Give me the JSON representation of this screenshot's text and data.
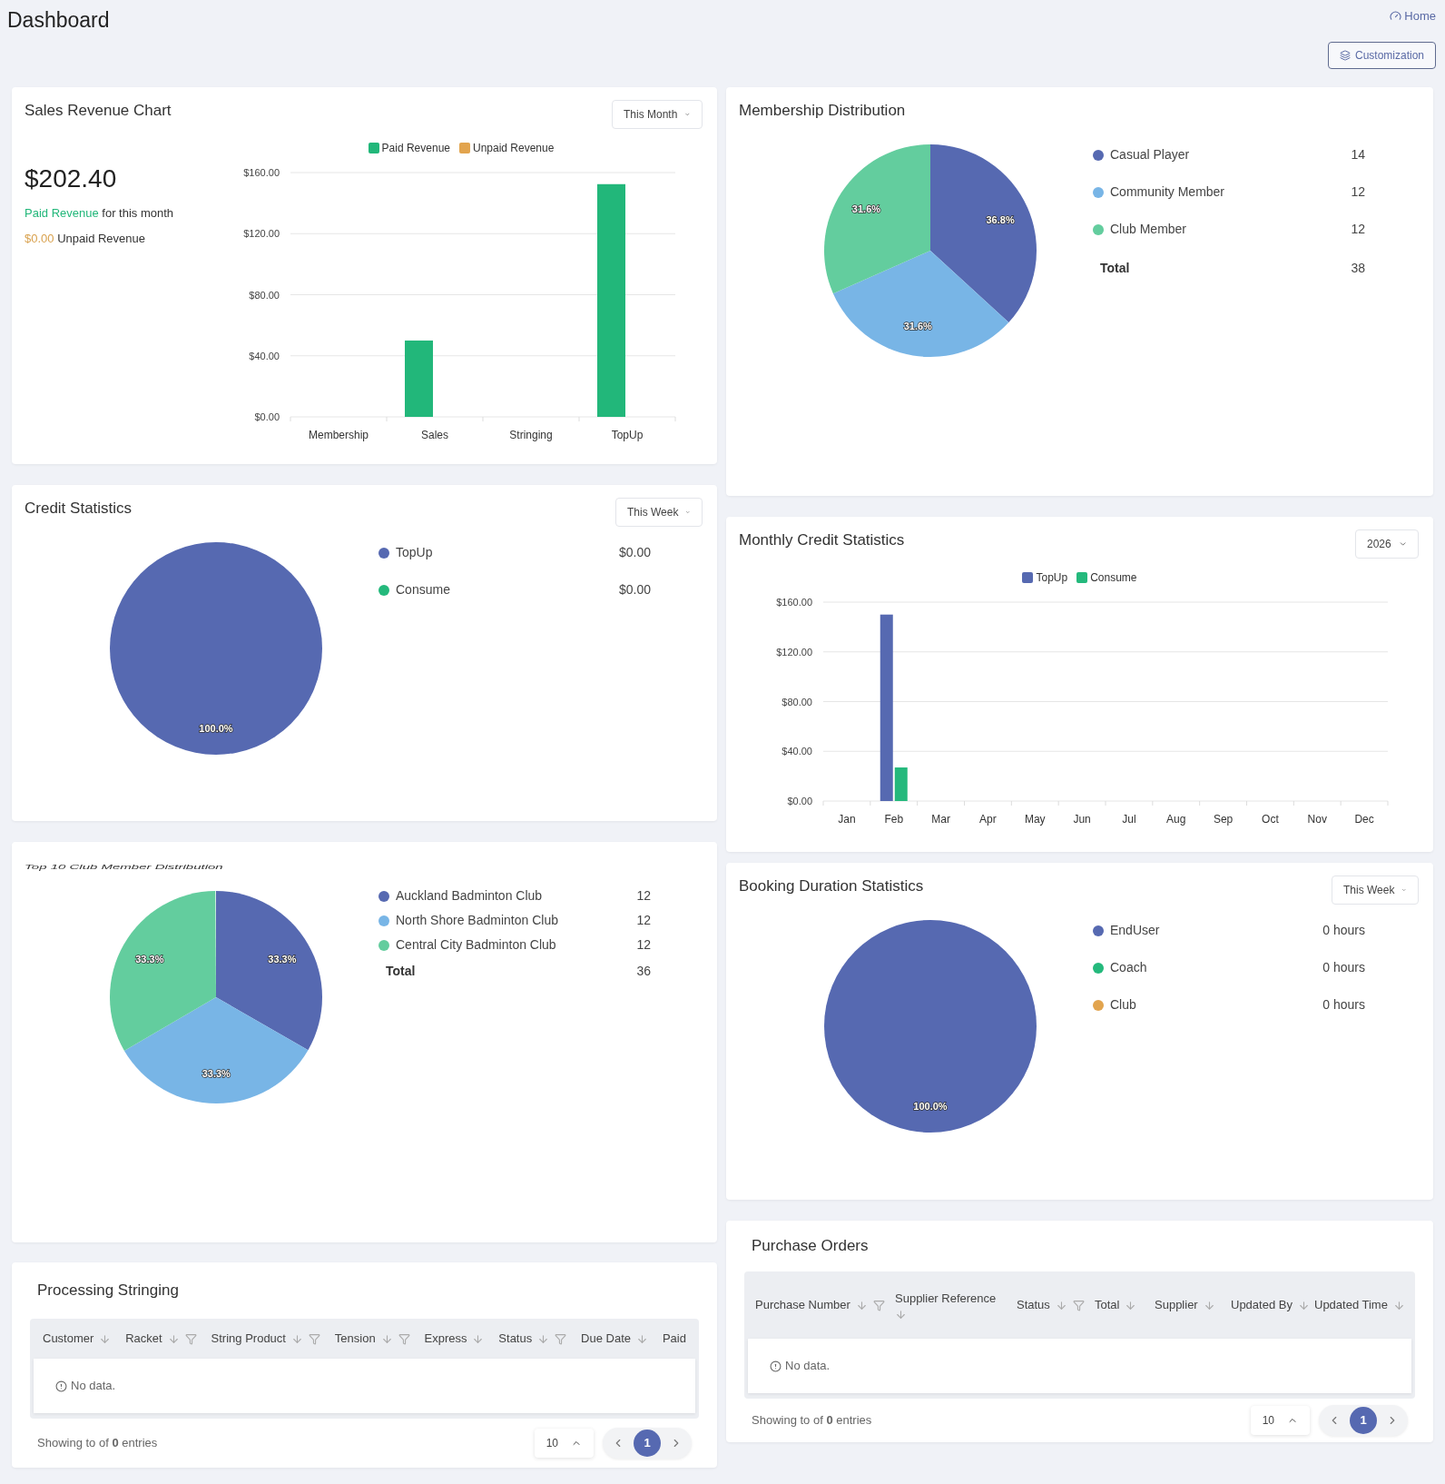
{
  "header": {
    "title": "Dashboard",
    "breadcrumb": "Home",
    "customize_button": "Customization"
  },
  "sales_revenue": {
    "title": "Sales Revenue Chart",
    "period": "This Month",
    "total": "$202.40",
    "paid_label": "Paid Revenue",
    "paid_suffix": "for this month",
    "unpaid_amount": "$0.00",
    "unpaid_label": "Unpaid Revenue",
    "chart_data": {
      "type": "bar",
      "grid": true,
      "categories": [
        "Membership",
        "Sales",
        "Stringing",
        "TopUp"
      ],
      "series": [
        {
          "name": "Paid Revenue",
          "color": "#22b77a",
          "values": [
            0,
            50,
            0,
            152.4
          ]
        },
        {
          "name": "Unpaid Revenue",
          "color": "#e2a44e",
          "values": [
            0,
            0,
            0,
            0
          ]
        }
      ],
      "ylim": [
        0,
        160
      ],
      "yticks": [
        {
          "value": 0,
          "label": "$0.00"
        },
        {
          "value": 40,
          "label": "$40.00"
        },
        {
          "value": 80,
          "label": "$80.00"
        },
        {
          "value": 120,
          "label": "$120.00"
        },
        {
          "value": 160,
          "label": "$160.00"
        }
      ]
    }
  },
  "membership_distribution": {
    "title": "Membership Distribution",
    "chart_data": {
      "type": "pie",
      "categories": [
        "Casual Player",
        "Community Member",
        "Club Member"
      ],
      "values": [
        36.8,
        31.6,
        31.6
      ],
      "value_labels": [
        "36.8%",
        "31.6%",
        "31.6%"
      ]
    },
    "legend": [
      {
        "value": "14",
        "color": "#5669b1"
      },
      {
        "value": "12",
        "color": "#78b5e6"
      },
      {
        "value": "12",
        "color": "#63cd9e"
      }
    ],
    "total": {
      "label": "Total",
      "value": "38"
    }
  },
  "credit_statistics": {
    "title": "Credit Statistics",
    "period": "This Week",
    "chart_data": {
      "type": "pie",
      "categories": [
        "TopUp",
        "Consume"
      ],
      "values": [
        100,
        0
      ],
      "value_labels": [
        "100.0%",
        null
      ]
    },
    "legend": [
      {
        "value": "$0.00",
        "color": "#5669b1"
      },
      {
        "value": "$0.00",
        "color": "#24b97c"
      }
    ]
  },
  "monthly_credit_statistics": {
    "title": "Monthly Credit Statistics",
    "year": "2026",
    "chart_data": {
      "type": "bar",
      "grid": true,
      "categories": [
        "Jan",
        "Feb",
        "Mar",
        "Apr",
        "May",
        "Jun",
        "Jul",
        "Aug",
        "Sep",
        "Oct",
        "Nov",
        "Dec"
      ],
      "series": [
        {
          "name": "TopUp",
          "color": "#5669b1",
          "values": [
            0,
            150,
            0,
            0,
            0,
            0,
            0,
            0,
            0,
            0,
            0,
            0
          ]
        },
        {
          "name": "Consume",
          "color": "#24b97c",
          "values": [
            0,
            27,
            0,
            0,
            0,
            0,
            0,
            0,
            0,
            0,
            0,
            0
          ]
        }
      ],
      "ylim": [
        0,
        160
      ],
      "yticks": [
        {
          "value": 0,
          "label": "$0.00"
        },
        {
          "value": 40,
          "label": "$40.00"
        },
        {
          "value": 80,
          "label": "$80.00"
        },
        {
          "value": 120,
          "label": "$120.00"
        },
        {
          "value": 160,
          "label": "$160.00"
        }
      ]
    }
  },
  "club_member_distribution": {
    "title": "Top 10 Club Member Distribution",
    "chart_data": {
      "type": "pie",
      "categories": [
        "Auckland Badminton Club",
        "North Shore Badminton Club",
        "Central City Badminton Club"
      ],
      "values": [
        33.3,
        33.3,
        33.3
      ],
      "value_labels": [
        "33.3%",
        "33.3%",
        "33.3%"
      ]
    },
    "legend": [
      {
        "value": "12",
        "color": "#5669b1"
      },
      {
        "value": "12",
        "color": "#78b5e6"
      },
      {
        "value": "12",
        "color": "#63cd9e"
      }
    ],
    "total": {
      "label": "Total",
      "value": "36"
    }
  },
  "booking_duration_statistics": {
    "title": "Booking Duration Statistics",
    "period": "This Week",
    "chart_data": {
      "type": "pie",
      "categories": [
        "EndUser",
        "Coach",
        "Club"
      ],
      "values": [
        100,
        0,
        0
      ],
      "value_labels": [
        "100.0%",
        null,
        null
      ]
    },
    "legend": [
      {
        "value": "0 hours",
        "color": "#5669b1"
      },
      {
        "value": "0 hours",
        "color": "#24b97c"
      },
      {
        "value": "0 hours",
        "color": "#e2a44e"
      }
    ]
  },
  "processing_stringing": {
    "title": "Processing Stringing",
    "columns": [
      {
        "label": "Customer",
        "sortable": true,
        "filterable": false
      },
      {
        "label": "Racket",
        "sortable": true,
        "filterable": true
      },
      {
        "label": "String Product",
        "sortable": true,
        "filterable": true
      },
      {
        "label": "Tension",
        "sortable": true,
        "filterable": true
      },
      {
        "label": "Express",
        "sortable": true,
        "filterable": false
      },
      {
        "label": "Status",
        "sortable": true,
        "filterable": true
      },
      {
        "label": "Due Date",
        "sortable": true,
        "filterable": false
      },
      {
        "label": "Paid",
        "sortable": false,
        "filterable": false
      }
    ],
    "empty_message": "No data.",
    "summary": "Showing to of **0** entries",
    "page_size": "10",
    "pages": [
      {
        "label": "1",
        "selected": true
      }
    ]
  },
  "purchase_orders": {
    "title": "Purchase Orders",
    "columns": [
      {
        "label": "Purchase Number",
        "sortable": true,
        "filterable": true
      },
      {
        "label": "Supplier Reference",
        "sortable": true,
        "filterable": false
      },
      {
        "label": "Status",
        "sortable": true,
        "filterable": true
      },
      {
        "label": "Total",
        "sortable": true,
        "filterable": false
      },
      {
        "label": "Supplier",
        "sortable": true,
        "filterable": false
      },
      {
        "label": "Updated By",
        "sortable": true,
        "filterable": false
      },
      {
        "label": "Updated Time",
        "sortable": true,
        "filterable": false
      }
    ],
    "empty_message": "No data.",
    "summary": "Showing to of **0** entries",
    "page_size": "10",
    "pages": [
      {
        "label": "1",
        "selected": true
      }
    ]
  }
}
